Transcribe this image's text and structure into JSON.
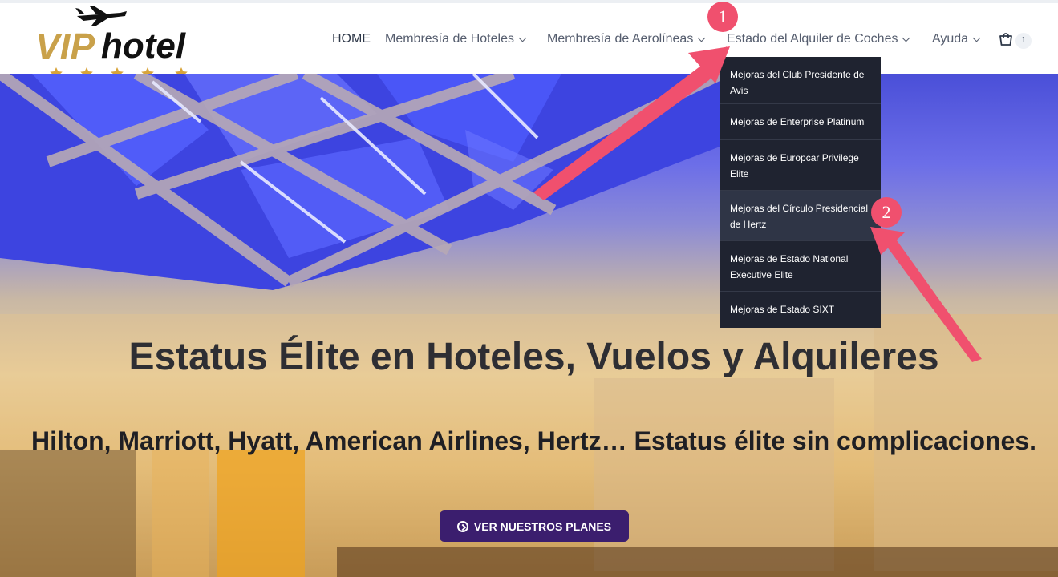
{
  "brand": {
    "logo_text_a": "VIP",
    "logo_text_b": "hotel"
  },
  "nav": {
    "items": [
      {
        "label": "HOME",
        "has_dropdown": false
      },
      {
        "label": "Membresía de Hoteles",
        "has_dropdown": true
      },
      {
        "label": "Membresía de Aerolíneas",
        "has_dropdown": true
      },
      {
        "label": "Estado del Alquiler de Coches",
        "has_dropdown": true
      },
      {
        "label": "Ayuda",
        "has_dropdown": true
      }
    ],
    "cart_count": "1"
  },
  "dropdown": {
    "items": [
      {
        "label": "Mejoras del Club Presidente de Avis"
      },
      {
        "label": "Mejoras de Enterprise Platinum"
      },
      {
        "label": "Mejoras de Europcar Privilege Elite"
      },
      {
        "label": "Mejoras del Círculo Presidencial de Hertz",
        "active": true
      },
      {
        "label": "Mejoras de Estado National Executive Elite"
      },
      {
        "label": "Mejoras de Estado SIXT"
      }
    ]
  },
  "hero": {
    "title": "Estatus Élite en Hoteles, Vuelos y Alquileres",
    "subtitle": "Hilton, Marriott, Hyatt, American Airlines, Hertz… Estatus élite sin complicaciones.",
    "cta_label": "VER NUESTROS PLANES"
  },
  "annotations": {
    "step1": "1",
    "step2": "2"
  },
  "colors": {
    "accent": "#3b1e6e",
    "annotation": "#f0506e",
    "dropdown_bg": "#1f2330",
    "logo_gold": "#c9a14a"
  }
}
